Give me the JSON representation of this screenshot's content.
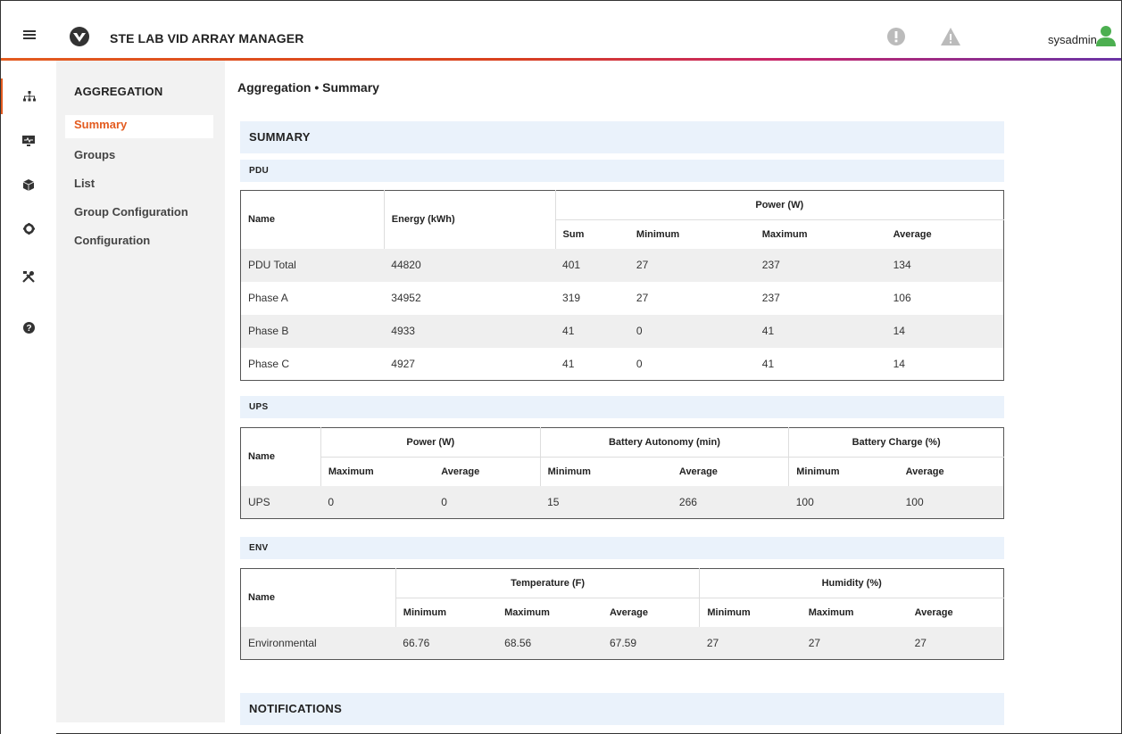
{
  "header": {
    "app_title": "STE LAB VID ARRAY MANAGER",
    "username": "sysadmin",
    "icons": [
      "hamburger-icon",
      "vertiv-logo",
      "alert-icon",
      "warning-icon",
      "user-icon"
    ]
  },
  "rail": {
    "icons": [
      "hierarchy-icon",
      "monitor-icon",
      "cube-icon",
      "gear-icon",
      "tools-icon",
      "help-icon"
    ],
    "active": "hierarchy-icon"
  },
  "subnav": {
    "heading": "AGGREGATION",
    "items": [
      {
        "label": "Summary",
        "active": true
      },
      {
        "label": "Groups"
      },
      {
        "label": "List"
      },
      {
        "label": "Group Configuration"
      },
      {
        "label": "Configuration"
      }
    ]
  },
  "breadcrumb": "Aggregation • Summary",
  "summary": {
    "title": "SUMMARY",
    "pdu": {
      "title": "PDU",
      "headers": {
        "name": "Name",
        "energy": "Energy (kWh)",
        "power": "Power (W)",
        "sum": "Sum",
        "minimum": "Minimum",
        "maximum": "Maximum",
        "average": "Average"
      },
      "rows": [
        {
          "name": "PDU Total",
          "energy": "44820",
          "sum": "401",
          "min": "27",
          "max": "237",
          "avg": "134"
        },
        {
          "name": "Phase A",
          "energy": "34952",
          "sum": "319",
          "min": "27",
          "max": "237",
          "avg": "106"
        },
        {
          "name": "Phase B",
          "energy": "4933",
          "sum": "41",
          "min": "0",
          "max": "41",
          "avg": "14"
        },
        {
          "name": "Phase C",
          "energy": "4927",
          "sum": "41",
          "min": "0",
          "max": "41",
          "avg": "14"
        }
      ]
    },
    "ups": {
      "title": "UPS",
      "headers": {
        "name": "Name",
        "power": "Power (W)",
        "autonomy": "Battery Autonomy (min)",
        "charge": "Battery Charge (%)",
        "maximum": "Maximum",
        "average": "Average",
        "minimum": "Minimum"
      },
      "rows": [
        {
          "name": "UPS",
          "power_max": "0",
          "power_avg": "0",
          "aut_min": "15",
          "aut_avg": "266",
          "chg_min": "100",
          "chg_avg": "100"
        }
      ]
    },
    "env": {
      "title": "ENV",
      "headers": {
        "name": "Name",
        "temperature": "Temperature (F)",
        "humidity": "Humidity (%)",
        "minimum": "Minimum",
        "maximum": "Maximum",
        "average": "Average"
      },
      "rows": [
        {
          "name": "Environmental",
          "t_min": "66.76",
          "t_max": "68.56",
          "t_avg": "67.59",
          "h_min": "27",
          "h_max": "27",
          "h_avg": "27"
        }
      ]
    }
  },
  "notifications": {
    "title": "NOTIFICATIONS"
  },
  "colors": {
    "accent": "#e35b1f",
    "user_icon": "#4caf50",
    "section_bg": "#eaf2fb",
    "row_shade": "#efefef"
  }
}
